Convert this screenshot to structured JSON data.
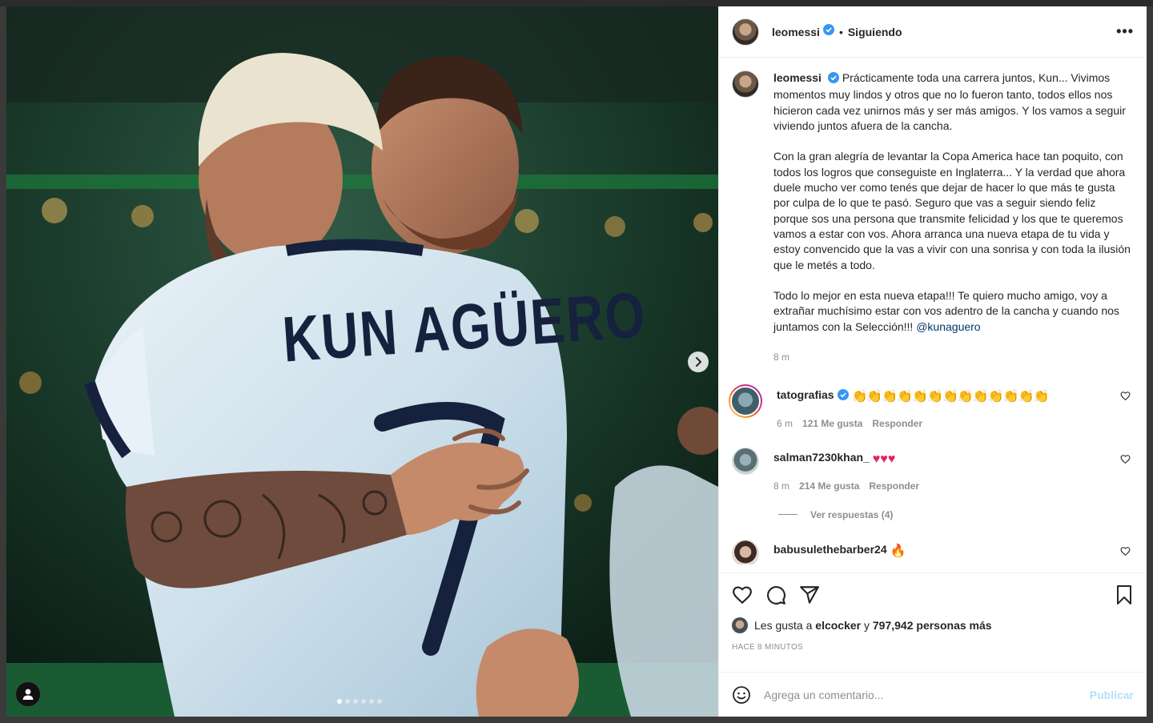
{
  "post": {
    "jersey_text": "KUN AGÜERO"
  },
  "header": {
    "username": "leomessi",
    "separator": "•",
    "follow_status": "Siguiendo",
    "more_label": "•••"
  },
  "caption": {
    "username": "leomessi",
    "paragraphs": [
      "Prácticamente toda una carrera juntos, Kun... Vivimos momentos muy lindos y otros que no lo fueron tanto, todos ellos nos hicieron cada vez unirnos más y ser más amigos. Y los vamos a seguir viviendo juntos afuera de la cancha.",
      "Con la gran alegría de levantar la Copa America hace tan poquito, con todos los logros que conseguiste en Inglaterra... Y la verdad que ahora duele mucho ver como tenés que dejar de hacer lo que más te gusta por culpa de lo que te pasó. Seguro que vas a seguir siendo feliz porque sos una persona que transmite felicidad y los que te queremos vamos a estar con vos. Ahora arranca una nueva etapa de tu vida y estoy convencido que la vas a vivir con una sonrisa y con toda la ilusión que le metés a todo.",
      "Todo lo mejor en esta nueva etapa!!! Te quiero mucho amigo, voy a extrañar muchísimo estar con vos adentro de la cancha y cuando nos juntamos con la Selección!!!"
    ],
    "mention": "@kunaguero",
    "time": "8 m"
  },
  "comments": [
    {
      "username": "tatografias",
      "text": "👏👏👏👏👏👏👏👏👏👏👏👏👏",
      "time": "6 m",
      "likes": "121 Me gusta",
      "reply": "Responder"
    },
    {
      "username": "salman7230khan_",
      "text": "♥♥♥",
      "time": "8 m",
      "likes": "214 Me gusta",
      "reply": "Responder",
      "view_replies": "Ver respuestas (4)"
    },
    {
      "username": "babusulethebarber24",
      "text": "🔥"
    }
  ],
  "likes": {
    "prefix": "Les gusta a",
    "user": "elcocker",
    "connector": "y",
    "others": "797,942 personas más"
  },
  "timestamp": "HACE 8 MINUTOS",
  "add_comment": {
    "placeholder": "Agrega un comentario...",
    "publish_label": "Publicar"
  },
  "colors": {
    "verified": "#3897f0",
    "link": "#00376b",
    "muted": "#8e8e8e",
    "publish_disabled": "#b2dffc"
  }
}
